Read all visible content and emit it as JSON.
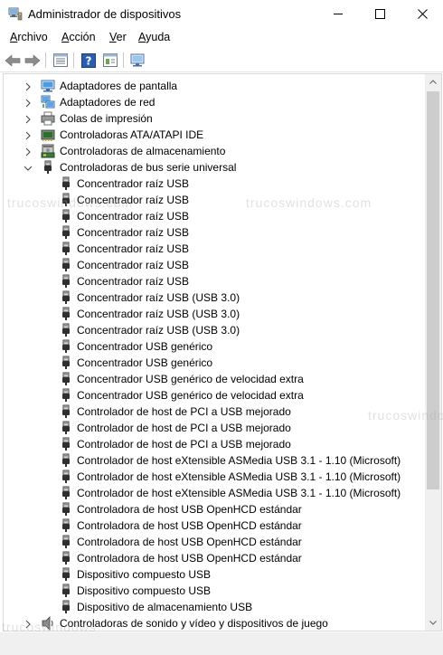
{
  "window": {
    "title": "Administrador de dispositivos"
  },
  "menu": [
    {
      "label_u": "A",
      "label_rest": "rchivo"
    },
    {
      "label_u": "A",
      "label_rest": "cción"
    },
    {
      "label_u": "V",
      "label_rest": "er"
    },
    {
      "label_u": "A",
      "label_rest": "yuda"
    }
  ],
  "watermark": {
    "text": "trucoswindows.com",
    "text_partial": "trucoswindo",
    "text_left": "trucoswindows"
  },
  "tree": {
    "categories_top": [
      {
        "label": "Adaptadores de pantalla",
        "icon": "display-adapter-icon"
      },
      {
        "label": "Adaptadores de red",
        "icon": "network-adapter-icon"
      },
      {
        "label": "Colas de impresión",
        "icon": "printer-icon"
      },
      {
        "label": "Controladoras ATA/ATAPI IDE",
        "icon": "ide-controller-icon"
      },
      {
        "label": "Controladoras de almacenamiento",
        "icon": "storage-controller-icon"
      }
    ],
    "expanded_category": {
      "label": "Controladoras de bus serie universal",
      "icon": "usb-icon"
    },
    "usb_devices": [
      "Concentrador raíz USB",
      "Concentrador raíz USB",
      "Concentrador raíz USB",
      "Concentrador raíz USB",
      "Concentrador raíz USB",
      "Concentrador raíz USB",
      "Concentrador raíz USB",
      "Concentrador raíz USB (USB 3.0)",
      "Concentrador raíz USB (USB 3.0)",
      "Concentrador raíz USB (USB 3.0)",
      "Concentrador USB genérico",
      "Concentrador USB genérico",
      "Concentrador USB genérico de velocidad extra",
      "Concentrador USB genérico de velocidad extra",
      "Controlador de host de PCI a USB mejorado",
      "Controlador de host de PCI a USB mejorado",
      "Controlador de host de PCI a USB mejorado",
      "Controlador de host eXtensible ASMedia USB 3.1 - 1.10 (Microsoft)",
      "Controlador de host eXtensible ASMedia USB 3.1 - 1.10 (Microsoft)",
      "Controlador de host eXtensible ASMedia USB 3.1 - 1.10 (Microsoft)",
      "Controladora de host USB OpenHCD estándar",
      "Controladora de host USB OpenHCD estándar",
      "Controladora de host USB OpenHCD estándar",
      "Controladora de host USB OpenHCD estándar",
      "Dispositivo compuesto USB",
      "Dispositivo compuesto USB",
      "Dispositivo de almacenamiento USB"
    ],
    "categories_bottom": [
      {
        "label": "Controladoras de sonido y vídeo y dispositivos de juego",
        "icon": "speaker-icon"
      }
    ]
  }
}
